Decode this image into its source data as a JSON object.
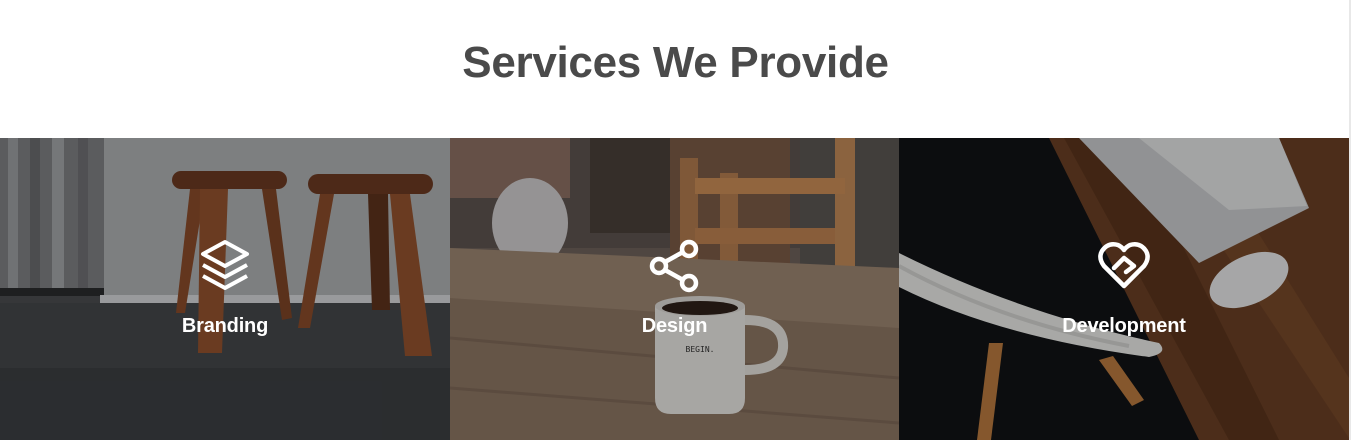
{
  "section": {
    "title": "Services We Provide"
  },
  "services": [
    {
      "label": "Branding",
      "icon": "layers-icon"
    },
    {
      "label": "Design",
      "icon": "share-icon"
    },
    {
      "label": "Development",
      "icon": "heart-icon"
    }
  ],
  "photo_text": {
    "mug_print": "BEGIN."
  },
  "colors": {
    "title": "#4a4a4a",
    "label": "#ffffff"
  }
}
